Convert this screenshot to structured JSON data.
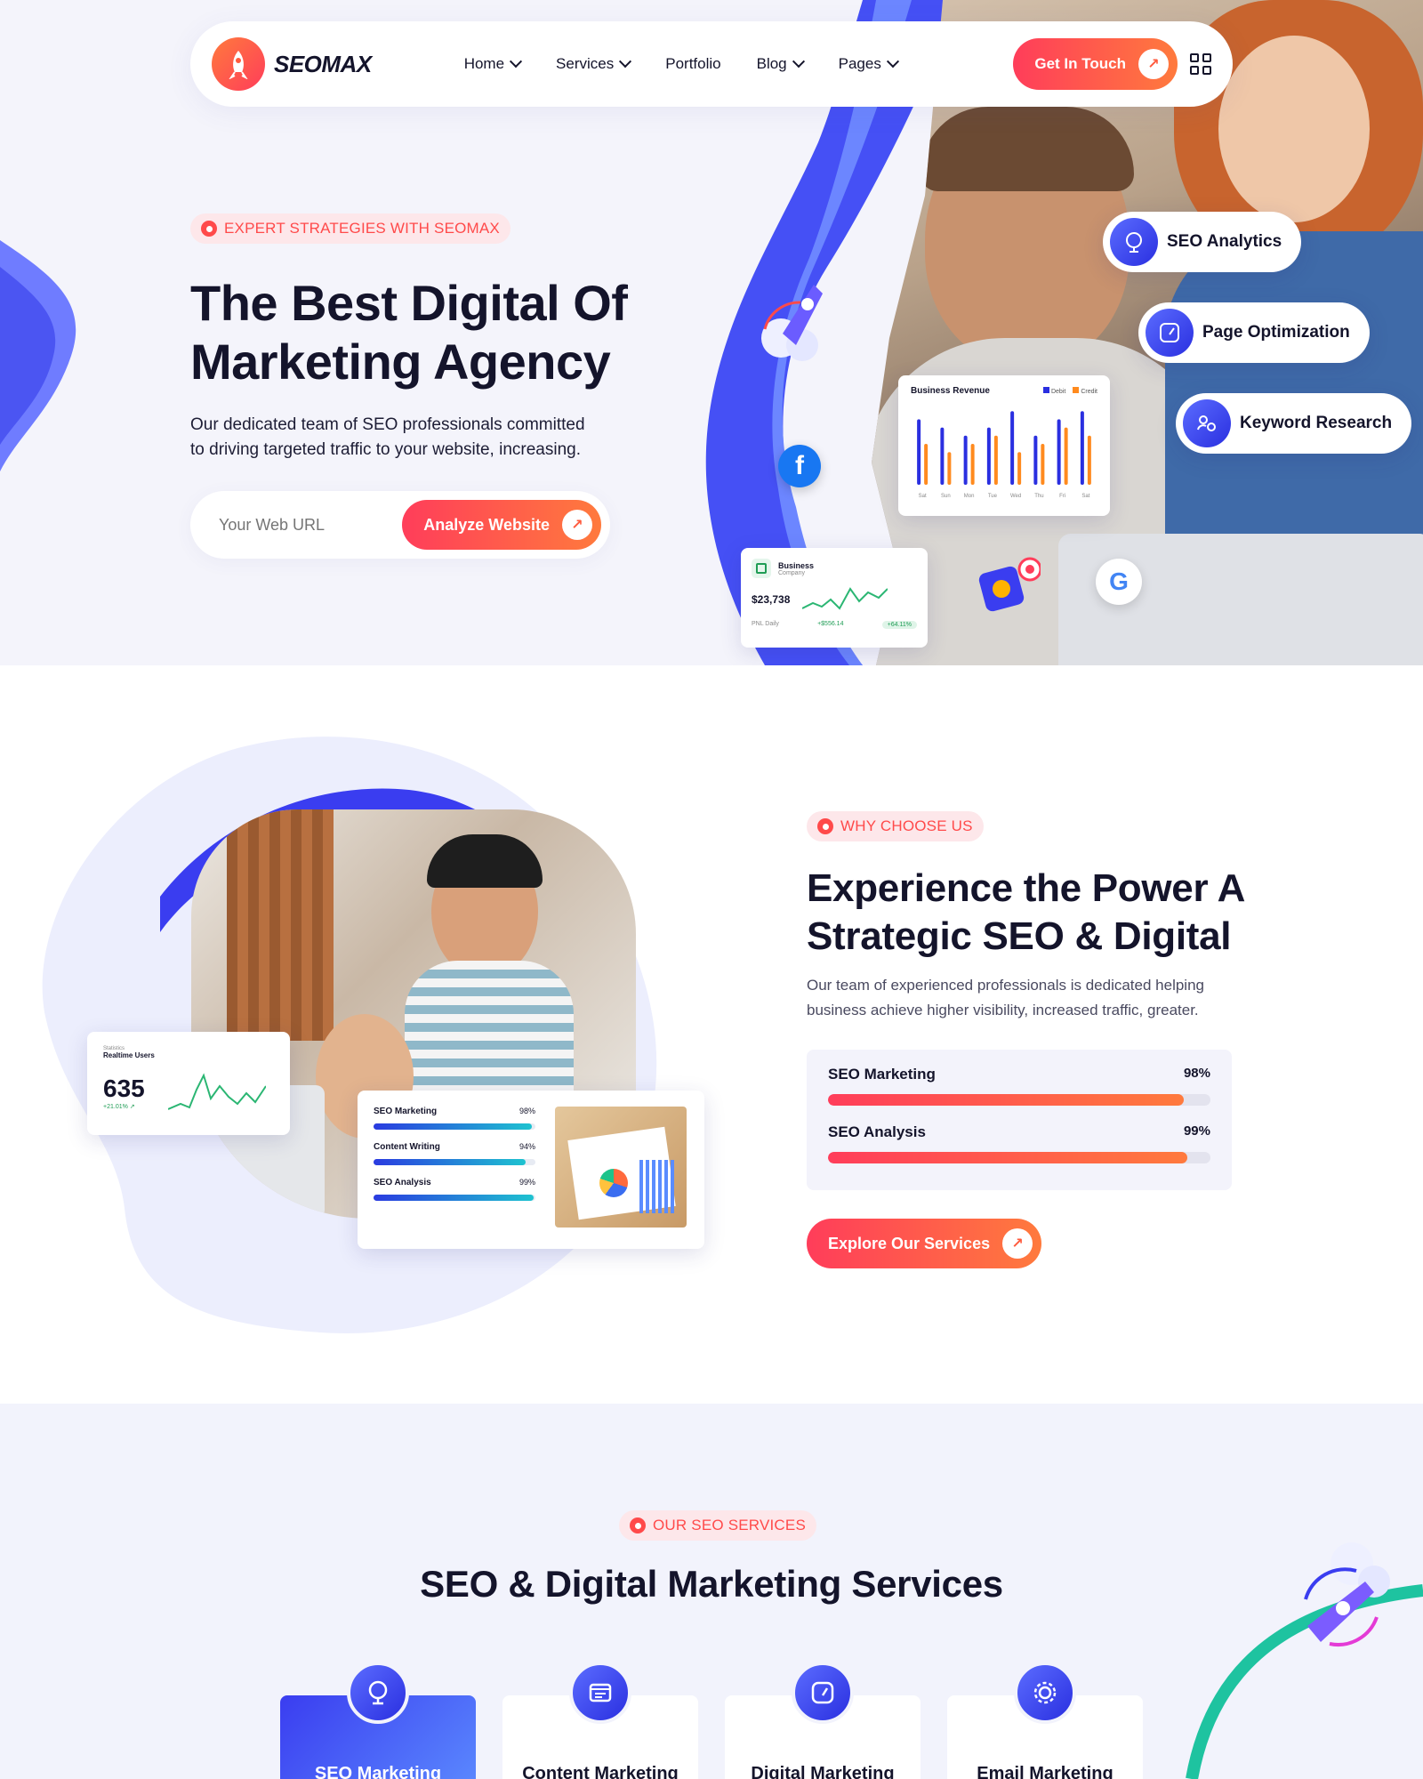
{
  "brand": {
    "name": "SEOMAX"
  },
  "nav": {
    "items": [
      {
        "label": "Home",
        "has_dropdown": true
      },
      {
        "label": "Services",
        "has_dropdown": true
      },
      {
        "label": "Portfolio",
        "has_dropdown": false
      },
      {
        "label": "Blog",
        "has_dropdown": true
      },
      {
        "label": "Pages",
        "has_dropdown": true
      }
    ],
    "cta_label": "Get In Touch"
  },
  "hero": {
    "tag": "EXPERT STRATEGIES WITH SEOMAX",
    "title_line1": "The Best Digital Of",
    "title_line2": "Marketing Agency",
    "desc_line1": "Our dedicated team of SEO professionals committed",
    "desc_line2": "to driving targeted traffic to your website, increasing.",
    "url_placeholder": "Your Web URL",
    "analyze_label": "Analyze Website",
    "pills": [
      "SEO Analytics",
      "Page Optimization",
      "Keyword Research"
    ],
    "revenue_card": {
      "title": "Business Revenue",
      "legend": [
        "Debit",
        "Credit"
      ],
      "days": [
        "Sat",
        "Sun",
        "Mon",
        "Tue",
        "Wed",
        "Thu",
        "Fri",
        "Sat"
      ],
      "debit": [
        8,
        7,
        6,
        7,
        9,
        6,
        8,
        9
      ],
      "credit": [
        5,
        4,
        5,
        6,
        4,
        5,
        7,
        6
      ]
    },
    "business_card": {
      "title": "Business",
      "subtitle": "Company",
      "amount": "$23,738",
      "label": "PNL Daily",
      "change": "+$556.14",
      "percent": "+64.11%"
    }
  },
  "why": {
    "tag": "WHY CHOOSE US",
    "title_line1": "Experience the Power A",
    "title_line2": "Strategic SEO & Digital",
    "desc_line1": "Our team of experienced professionals is dedicated helping",
    "desc_line2": "business achieve higher visibility, increased traffic, greater.",
    "progress": [
      {
        "label": "SEO Marketing",
        "value": "98%",
        "fraction": 0.93
      },
      {
        "label": "SEO Analysis",
        "value": "99%",
        "fraction": 0.94
      }
    ],
    "explore_label": "Explore Our Services",
    "stat_card": {
      "small": "Statistics",
      "title": "Realtime Users",
      "value": "635",
      "change": "+21.01%"
    },
    "skills_card": [
      {
        "label": "SEO Marketing",
        "value": "98%",
        "fraction": 0.98
      },
      {
        "label": "Content Writing",
        "value": "94%",
        "fraction": 0.94
      },
      {
        "label": "SEO Analysis",
        "value": "99%",
        "fraction": 0.99
      }
    ]
  },
  "services": {
    "tag": "OUR SEO SERVICES",
    "title": "SEO & Digital Marketing Services",
    "items": [
      {
        "label": "SEO Marketing",
        "icon": "globe-icon",
        "active": true
      },
      {
        "label": "Content Marketing",
        "icon": "content-icon",
        "active": false
      },
      {
        "label": "Digital Marketing",
        "icon": "gauge-icon",
        "active": false
      },
      {
        "label": "Email Marketing",
        "icon": "gear-icon",
        "active": false
      }
    ]
  },
  "colors": {
    "accent": "#ff4a4a",
    "accent2": "#ff7a3d",
    "blue": "#3a3df0",
    "teal": "#1ec3a0"
  }
}
